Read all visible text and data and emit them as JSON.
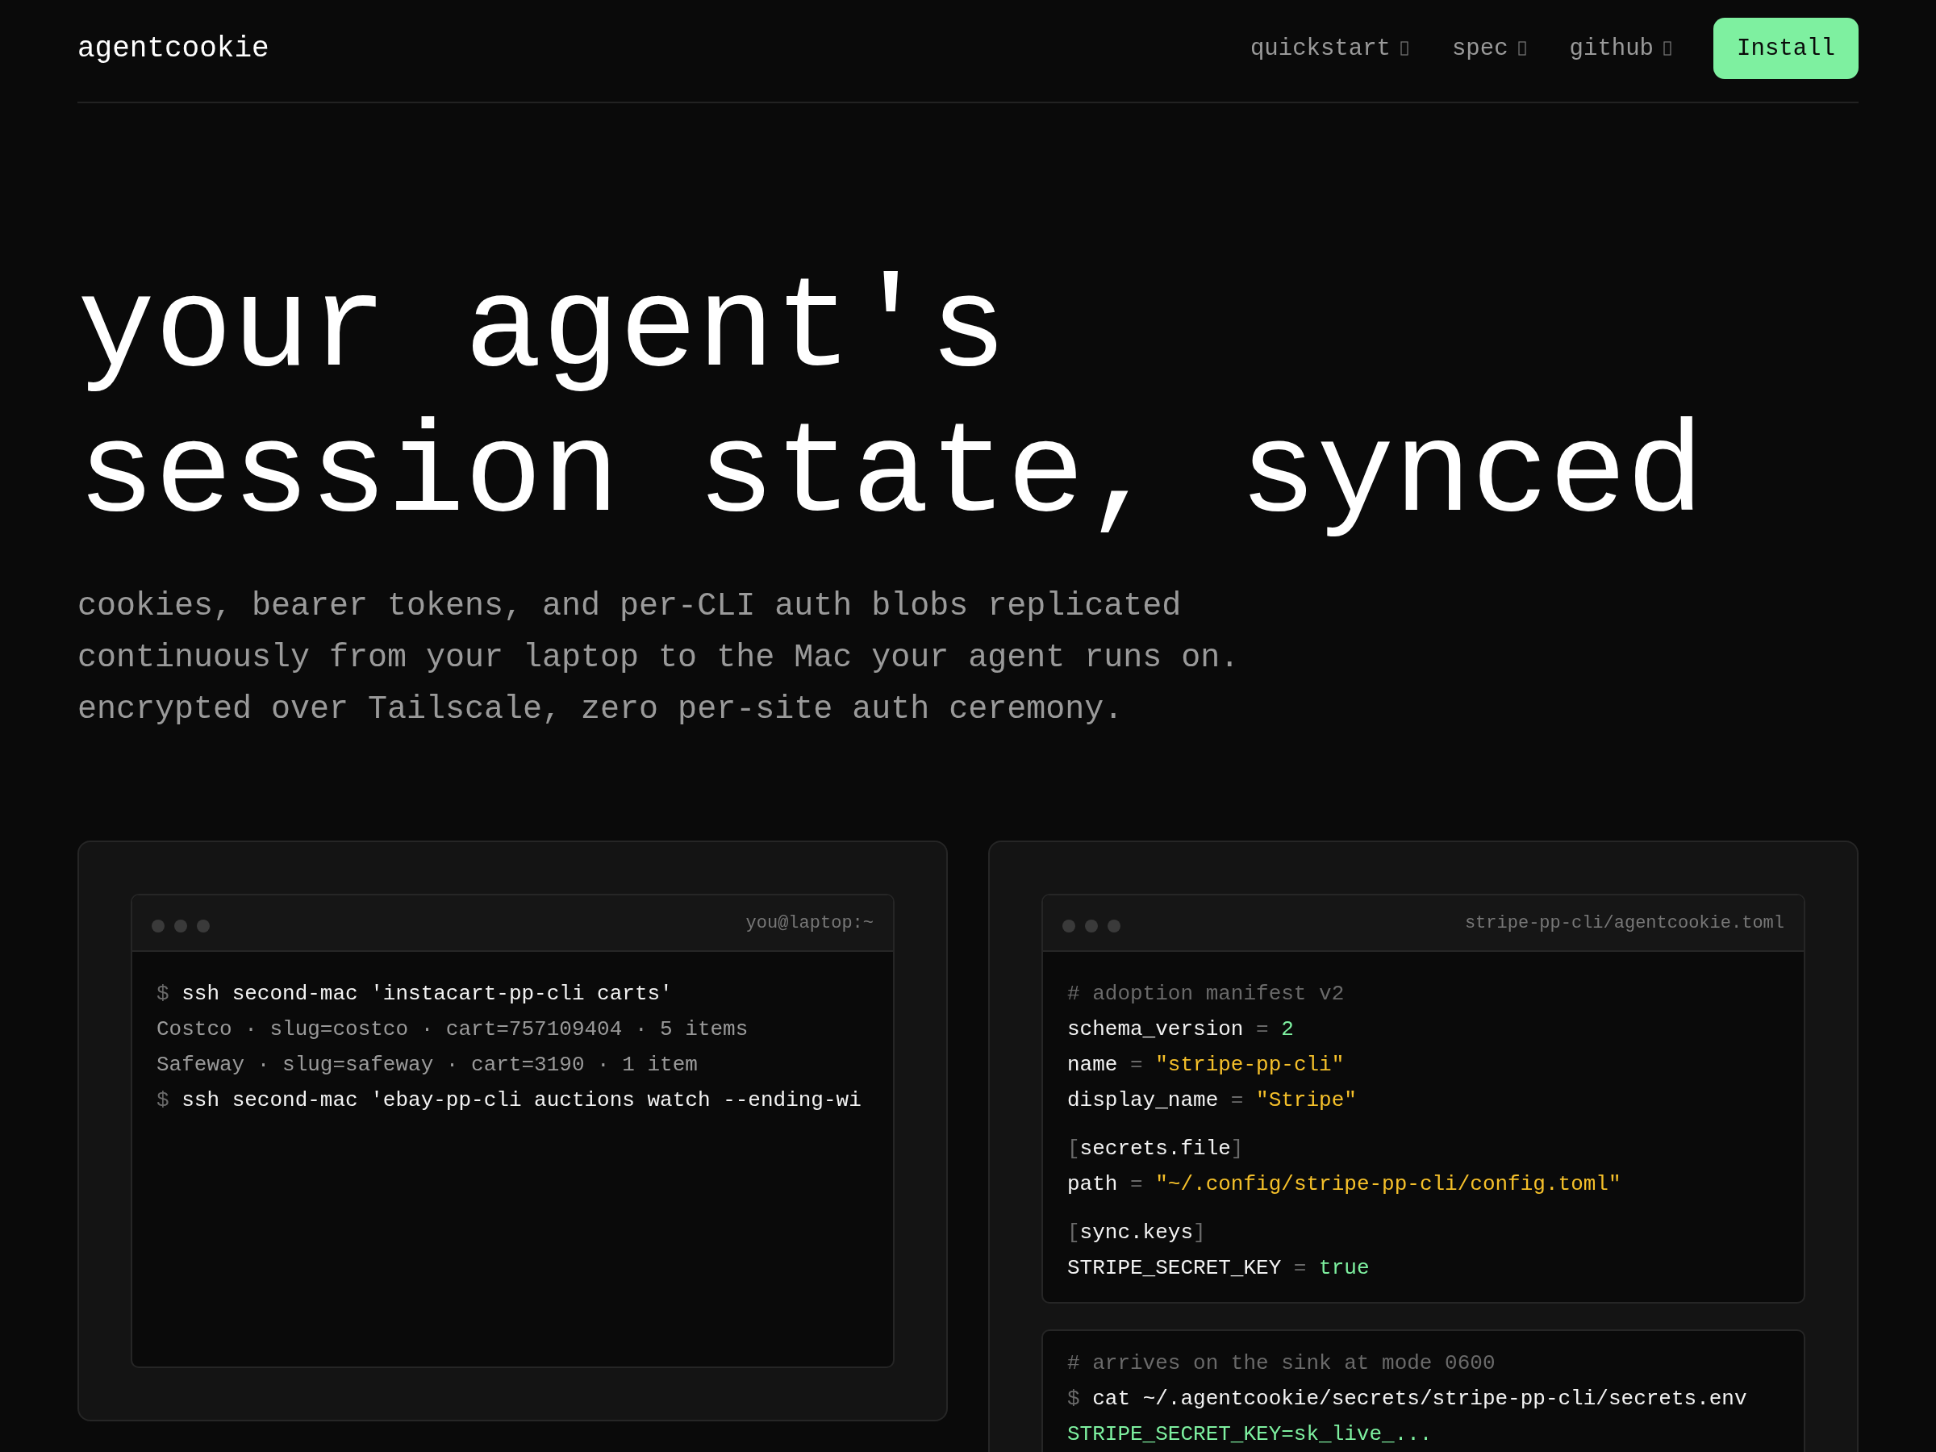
{
  "nav": {
    "logo": "agentcookie",
    "links": [
      {
        "label": "quickstart"
      },
      {
        "label": "spec"
      },
      {
        "label": "github"
      }
    ],
    "install_button": "Install"
  },
  "hero": {
    "headline_lines": [
      "your agent's",
      "session state, synced"
    ],
    "subtitle_lines": [
      "cookies, bearer tokens, and per-CLI auth blobs replicated",
      "continuously from your laptop to the Mac your agent runs on.",
      "encrypted over Tailscale, zero per-site auth ceremony."
    ]
  },
  "cards": [
    {
      "terminals": [
        {
          "title": "you@laptop:~",
          "blocks": [
            [
              {
                "tokens": [
                  {
                    "kind": "prompt",
                    "text": "$"
                  },
                  {
                    "kind": "cmd",
                    "text": "ssh second-mac 'instacart-pp-cli carts'"
                  }
                ]
              },
              {
                "tokens": [
                  {
                    "kind": "output",
                    "text": "Costco · slug=costco · cart=757109404 · 5 items"
                  }
                ]
              },
              {
                "tokens": [
                  {
                    "kind": "output",
                    "text": "Safeway · slug=safeway · cart=3190 · 1 item"
                  }
                ]
              },
              {
                "tokens": [
                  {
                    "kind": "prompt",
                    "text": "$"
                  },
                  {
                    "kind": "cmd",
                    "text": "ssh second-mac 'ebay-pp-cli auctions watch --ending-wi"
                  }
                ]
              }
            ]
          ]
        }
      ]
    },
    {
      "terminals": [
        {
          "title": "stripe-pp-cli/agentcookie.toml",
          "blocks": [
            [
              {
                "tokens": [
                  {
                    "kind": "comment",
                    "text": "# adoption manifest v2"
                  }
                ]
              },
              {
                "tokens": [
                  {
                    "kind": "key",
                    "text": "schema_version"
                  },
                  {
                    "kind": "op",
                    "text": "="
                  },
                  {
                    "kind": "green",
                    "text": "2"
                  }
                ]
              },
              {
                "tokens": [
                  {
                    "kind": "key",
                    "text": "name"
                  },
                  {
                    "kind": "op",
                    "text": "="
                  },
                  {
                    "kind": "string",
                    "text": "\"stripe-pp-cli\""
                  }
                ]
              },
              {
                "tokens": [
                  {
                    "kind": "key",
                    "text": "display_name"
                  },
                  {
                    "kind": "op",
                    "text": "="
                  },
                  {
                    "kind": "string",
                    "text": "\"Stripe\""
                  }
                ]
              }
            ],
            [
              {
                "tokens": [
                  {
                    "kind": "bracket",
                    "text": "["
                  },
                  {
                    "kind": "section",
                    "text": "secrets.file"
                  },
                  {
                    "kind": "bracket",
                    "text": "]"
                  }
                ]
              },
              {
                "tokens": [
                  {
                    "kind": "key",
                    "text": "path"
                  },
                  {
                    "kind": "op",
                    "text": "="
                  },
                  {
                    "kind": "string",
                    "text": "\"~/.config/stripe-pp-cli/config.toml\""
                  }
                ]
              }
            ],
            [
              {
                "tokens": [
                  {
                    "kind": "bracket",
                    "text": "["
                  },
                  {
                    "kind": "section",
                    "text": "sync.keys"
                  },
                  {
                    "kind": "bracket",
                    "text": "]"
                  }
                ]
              },
              {
                "tokens": [
                  {
                    "kind": "key",
                    "text": "STRIPE_SECRET_KEY"
                  },
                  {
                    "kind": "op",
                    "text": "="
                  },
                  {
                    "kind": "green",
                    "text": "true"
                  }
                ]
              }
            ]
          ]
        },
        {
          "blocks": [
            [
              {
                "tokens": [
                  {
                    "kind": "comment",
                    "text": "# arrives on the sink at mode 0600"
                  }
                ]
              },
              {
                "tokens": [
                  {
                    "kind": "prompt",
                    "text": "$"
                  },
                  {
                    "kind": "cmd",
                    "text": "cat ~/.agentcookie/secrets/stripe-pp-cli/secrets.env"
                  }
                ]
              },
              {
                "tokens": [
                  {
                    "kind": "green",
                    "text": "STRIPE_SECRET_KEY=sk_live_..."
                  }
                ]
              }
            ]
          ]
        }
      ]
    }
  ]
}
